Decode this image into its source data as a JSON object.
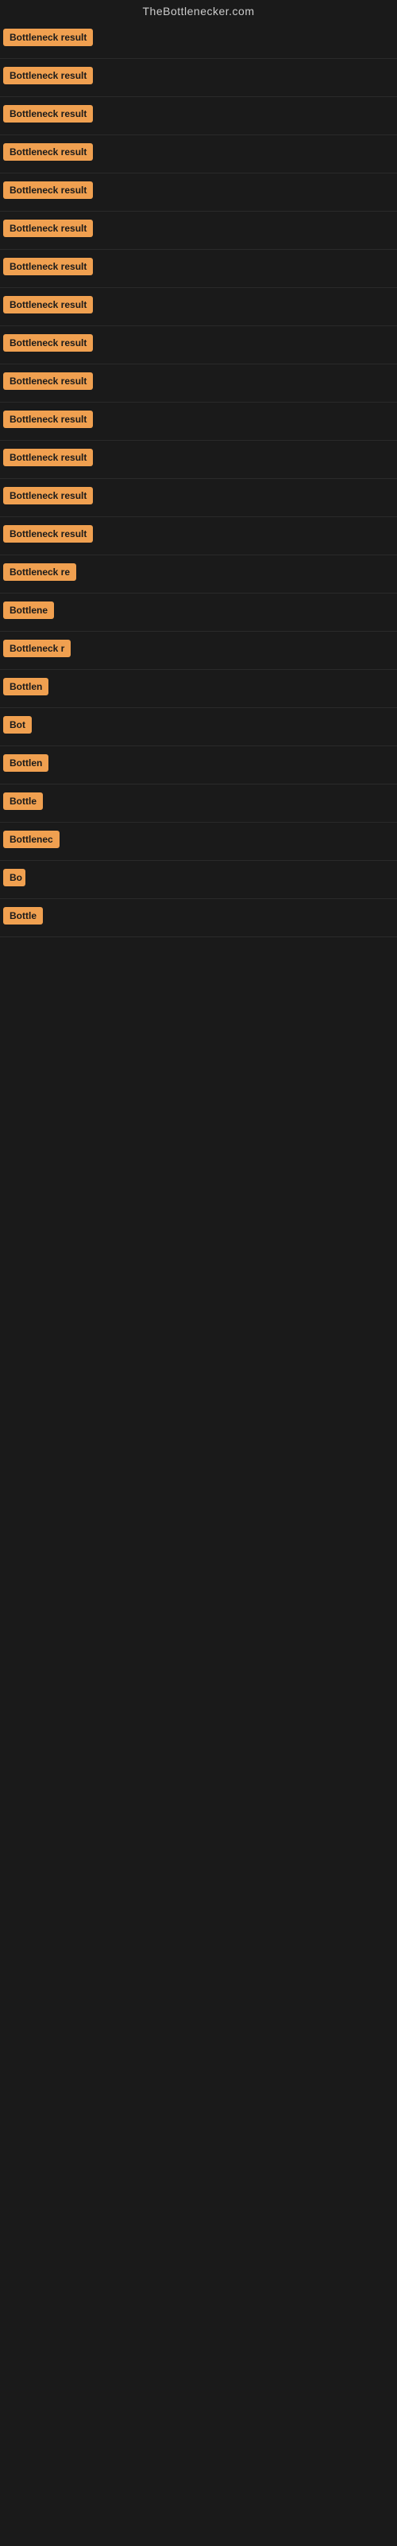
{
  "site": {
    "title": "TheBottlenecker.com"
  },
  "rows": [
    {
      "label": "Bottleneck result",
      "width": 120
    },
    {
      "label": "Bottleneck result",
      "width": 120
    },
    {
      "label": "Bottleneck result",
      "width": 120
    },
    {
      "label": "Bottleneck result",
      "width": 120
    },
    {
      "label": "Bottleneck result",
      "width": 120
    },
    {
      "label": "Bottleneck result",
      "width": 120
    },
    {
      "label": "Bottleneck result",
      "width": 120
    },
    {
      "label": "Bottleneck result",
      "width": 120
    },
    {
      "label": "Bottleneck result",
      "width": 120
    },
    {
      "label": "Bottleneck result",
      "width": 120
    },
    {
      "label": "Bottleneck result",
      "width": 120
    },
    {
      "label": "Bottleneck result",
      "width": 120
    },
    {
      "label": "Bottleneck result",
      "width": 120
    },
    {
      "label": "Bottleneck result",
      "width": 120
    },
    {
      "label": "Bottleneck re",
      "width": 100
    },
    {
      "label": "Bottlene",
      "width": 80
    },
    {
      "label": "Bottleneck r",
      "width": 90
    },
    {
      "label": "Bottlen",
      "width": 72
    },
    {
      "label": "Bot",
      "width": 40
    },
    {
      "label": "Bottlen",
      "width": 72
    },
    {
      "label": "Bottle",
      "width": 60
    },
    {
      "label": "Bottlenec",
      "width": 85
    },
    {
      "label": "Bo",
      "width": 28
    },
    {
      "label": "Bottle",
      "width": 60
    }
  ]
}
